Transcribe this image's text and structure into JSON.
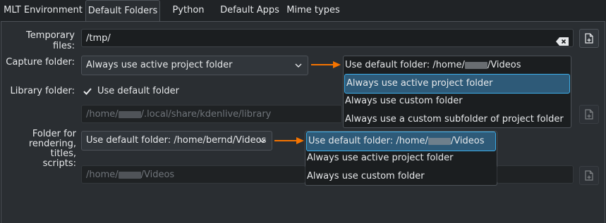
{
  "tabs": [
    "MLT Environment",
    "Default Folders",
    "Python",
    "Default Apps",
    "Mime types"
  ],
  "temp": {
    "label": "Temporary files:",
    "value": "/tmp/"
  },
  "capture": {
    "label": "Capture folder:",
    "selected": "Always use active project folder",
    "options": [
      {
        "before": "Use default folder: /home/",
        "after": "/Videos"
      },
      {
        "text": "Always use active project folder"
      },
      {
        "text": "Always use custom folder"
      },
      {
        "text": "Always use a custom subfolder of project folder"
      }
    ]
  },
  "library": {
    "label": "Library folder:",
    "checkbox_label": "Use default folder",
    "checked": true,
    "path_before": "/home/",
    "path_after": "/.local/share/kdenlive/library"
  },
  "rendering": {
    "label_lines": [
      "Folder for",
      "rendering, titles,",
      "scripts:"
    ],
    "selected": "Use default folder: /home/bernd/Videos",
    "options": [
      {
        "before": "Use default folder: /home/",
        "after": "/Videos"
      },
      {
        "text": "Always use active project folder"
      },
      {
        "text": "Always use custom folder"
      }
    ],
    "path_before": "/home/",
    "path_after": "/Videos"
  },
  "colors": {
    "accent": "#3daee9",
    "arrow": "#f67400",
    "selection": "#2e5a78"
  },
  "icons": [
    "clear-icon",
    "open-folder-icon",
    "chevron-down-icon",
    "checkmark-icon",
    "arrow-right-icon"
  ]
}
